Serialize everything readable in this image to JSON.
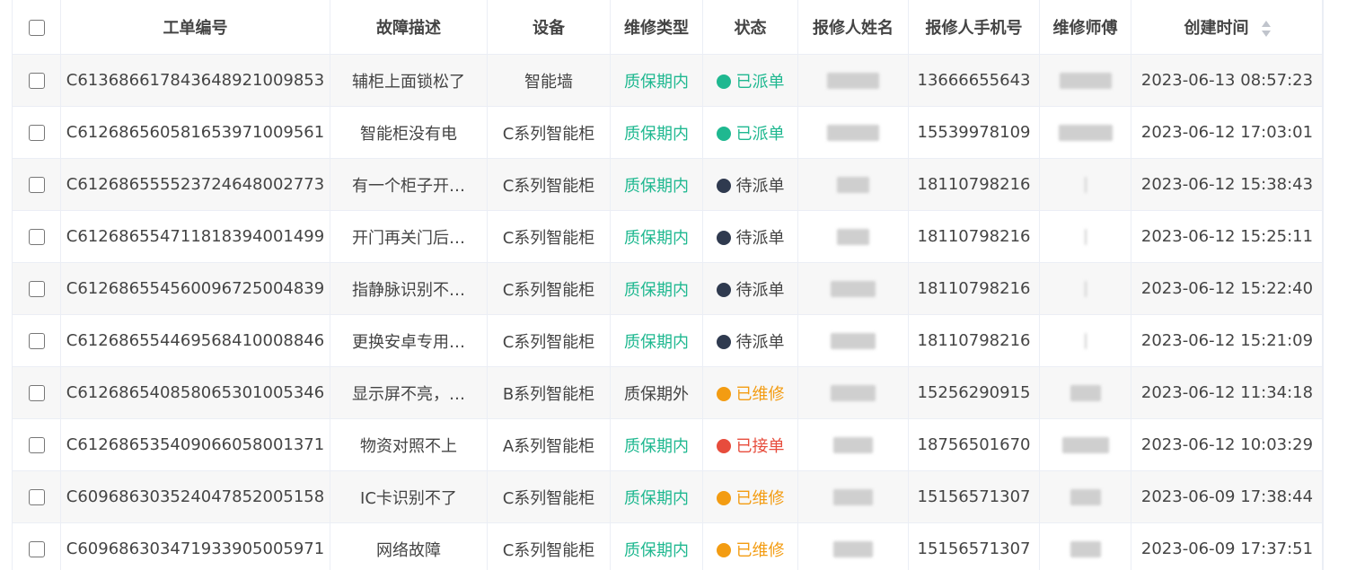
{
  "table": {
    "headers": {
      "order_no": "工单编号",
      "fault": "故障描述",
      "device": "设备",
      "repair_type": "维修类型",
      "status": "状态",
      "reporter_name": "报修人姓名",
      "reporter_phone": "报修人手机号",
      "technician": "维修师傅",
      "created": "创建时间"
    },
    "colors": {
      "in_warranty": "#1fb890",
      "dispatched": "#1fb890",
      "pending": "#2f3a4f",
      "repairing": "#f39c12",
      "accepted": "#e74c3c"
    },
    "rows": [
      {
        "order_no": "C613686617843648921009853",
        "fault": "辅柜上面锁松了",
        "device": "智能墙",
        "repair_type": "质保期内",
        "status": "已派单",
        "phone": "13666655643",
        "created": "2023-06-13 08:57:23"
      },
      {
        "order_no": "C612686560581653971009561",
        "fault": "智能柜没有电",
        "device": "C系列智能柜",
        "repair_type": "质保期内",
        "status": "已派单",
        "phone": "15539978109",
        "created": "2023-06-12 17:03:01"
      },
      {
        "order_no": "C612686555523724648002773",
        "fault": "有一个柜子开…",
        "device": "C系列智能柜",
        "repair_type": "质保期内",
        "status": "待派单",
        "phone": "18110798216",
        "created": "2023-06-12 15:38:43"
      },
      {
        "order_no": "C612686554711818394001499",
        "fault": "开门再关门后…",
        "device": "C系列智能柜",
        "repair_type": "质保期内",
        "status": "待派单",
        "phone": "18110798216",
        "created": "2023-06-12 15:25:11"
      },
      {
        "order_no": "C612686554560096725004839",
        "fault": "指静脉识别不…",
        "device": "C系列智能柜",
        "repair_type": "质保期内",
        "status": "待派单",
        "phone": "18110798216",
        "created": "2023-06-12 15:22:40"
      },
      {
        "order_no": "C612686554469568410008846",
        "fault": "更换安卓专用…",
        "device": "C系列智能柜",
        "repair_type": "质保期内",
        "status": "待派单",
        "phone": "18110798216",
        "created": "2023-06-12 15:21:09"
      },
      {
        "order_no": "C612686540858065301005346",
        "fault": "显示屏不亮，…",
        "device": "B系列智能柜",
        "repair_type": "质保期外",
        "status": "已维修",
        "phone": "15256290915",
        "created": "2023-06-12 11:34:18"
      },
      {
        "order_no": "C612686535409066058001371",
        "fault": "物资对照不上",
        "device": "A系列智能柜",
        "repair_type": "质保期内",
        "status": "已接单",
        "phone": "18756501670",
        "created": "2023-06-12 10:03:29"
      },
      {
        "order_no": "C609686303524047852005158",
        "fault": "IC卡识别不了",
        "device": "C系列智能柜",
        "repair_type": "质保期内",
        "status": "已维修",
        "phone": "15156571307",
        "created": "2023-06-09 17:38:44"
      },
      {
        "order_no": "C609686303471933905005971",
        "fault": "网络故障",
        "device": "C系列智能柜",
        "repair_type": "质保期内",
        "status": "已维修",
        "phone": "15156571307",
        "created": "2023-06-09 17:37:51"
      }
    ]
  }
}
